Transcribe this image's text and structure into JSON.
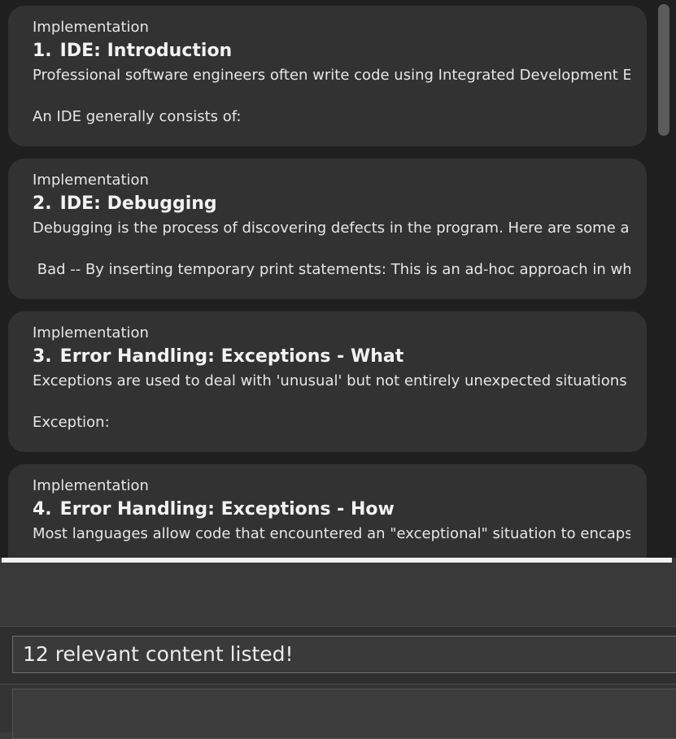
{
  "cards": [
    {
      "category": "Implementation",
      "number": "1.",
      "title": "IDE: Introduction",
      "description": "Professional software engineers often write code using Integrated Development Env...",
      "extra": "An IDE generally consists of:"
    },
    {
      "category": "Implementation",
      "number": "2.",
      "title": "IDE: Debugging",
      "description": "Debugging is the process of discovering defects in the program. Here are some app...",
      "extra": " Bad -- By inserting temporary print statements: This is an ad-hoc approach in which..."
    },
    {
      "category": "Implementation",
      "number": "3.",
      "title": "Error Handling: Exceptions - What",
      "description": "Exceptions are used to deal with 'unusual' but not entirely unexpected situations tha...",
      "extra": "Exception:"
    },
    {
      "category": "Implementation",
      "number": "4.",
      "title": "Error Handling: Exceptions - How",
      "description": "Most languages allow code that encountered an \"exceptional\" situation to encapsul...",
      "extra": ""
    }
  ],
  "result": {
    "text": "12 relevant content listed!"
  },
  "command": {
    "value": ""
  }
}
